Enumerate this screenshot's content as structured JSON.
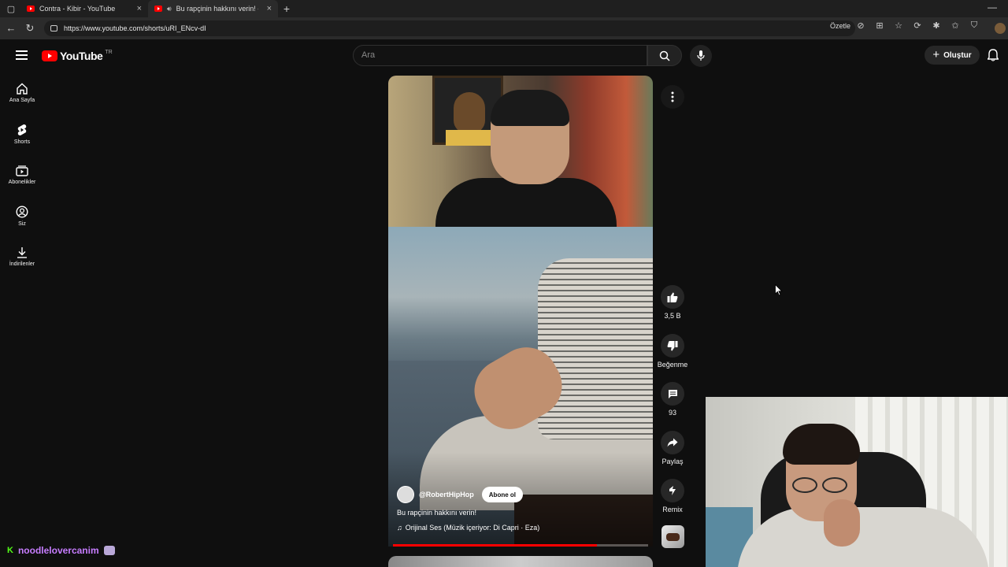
{
  "browser": {
    "tabs": [
      {
        "title": "Contra - Kibir - YouTube"
      },
      {
        "title": "Bu rapçinin hakkını verin! - Y"
      }
    ],
    "url": "https://www.youtube.com/shorts/uRI_ENcv-dI",
    "summarize_label": "Özetle"
  },
  "header": {
    "logo_text": "YouTube",
    "logo_region": "TR",
    "search_placeholder": "Ara",
    "create_label": "Oluştur"
  },
  "sidebar": {
    "items": [
      {
        "label": "Ana Sayfa",
        "icon": "home-icon"
      },
      {
        "label": "Shorts",
        "icon": "shorts-icon"
      },
      {
        "label": "Abonelikler",
        "icon": "subscriptions-icon"
      },
      {
        "label": "Siz",
        "icon": "account-icon"
      },
      {
        "label": "İndirilenler",
        "icon": "download-icon"
      }
    ]
  },
  "short": {
    "channel": "@RobertHipHop",
    "subscribe_label": "Abone ol",
    "title": "Bu rapçinin hakkını verin!",
    "sound": "Orijinal Ses (Müzik içeriyor: Di Capri · Eza)",
    "progress": 0.8
  },
  "actions": {
    "likes": "3,5 B",
    "dislike_label": "Beğenme",
    "comments": "93",
    "share_label": "Paylaş",
    "remix_label": "Remix"
  },
  "stream": {
    "chat_user": "noodlelovercanim"
  },
  "colors": {
    "accent": "#ff0000",
    "chat_name": "#c77dff",
    "kick_green": "#53fc18"
  }
}
